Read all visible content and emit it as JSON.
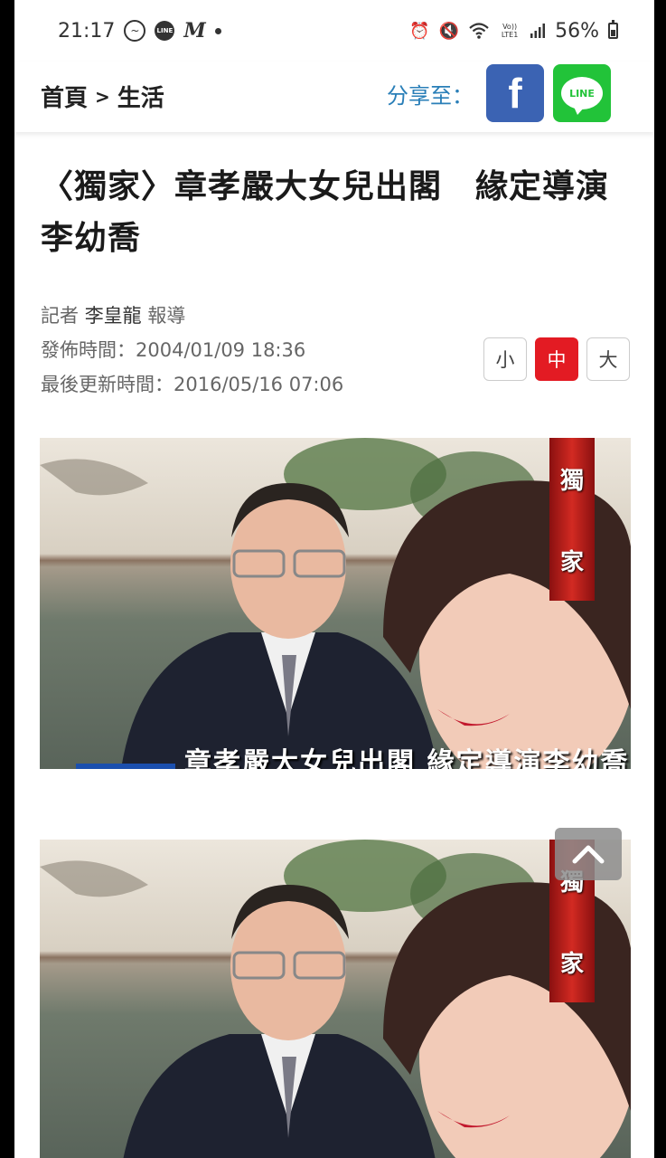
{
  "status_bar": {
    "time": "21:17",
    "battery": "56%",
    "left_icons": [
      "messenger-icon",
      "line-icon",
      "m-app-icon",
      "notification-dot-icon"
    ],
    "right_icons": [
      "alarm-icon",
      "mute-icon",
      "wifi-icon",
      "volte-icon",
      "signal-icon",
      "battery-icon"
    ],
    "volte_text": "Vo))\nLTE1",
    "line_badge": "LINE",
    "m_badge": "M",
    "battery_level": 0.56
  },
  "header": {
    "breadcrumb_home": "首頁",
    "breadcrumb_sep": ">",
    "breadcrumb_section": "生活",
    "share_label": "分享至：",
    "facebook_label": "f",
    "line_label": "LINE"
  },
  "article": {
    "title": "〈獨家〉章孝嚴大女兒出閣　緣定導演李幼喬",
    "reporter_prefix": "記者",
    "reporter_name": "李皇龍",
    "reporter_suffix": "報導",
    "published": "發佈時間：2004/01/09 18:36",
    "updated": "最後更新時間：2016/05/16 07:06"
  },
  "font_size": {
    "small": "小",
    "medium": "中",
    "large": "大",
    "active": "medium"
  },
  "photos": [
    {
      "tag_top": "獨",
      "tag_bottom": "家",
      "caption": "章孝嚴大女兒出閣 緣定導演李幼喬"
    },
    {
      "tag_top": "獨",
      "tag_bottom": "家"
    }
  ],
  "colors": {
    "accent_red": "#e31b23",
    "facebook_blue": "#3b63b3",
    "line_green": "#22c339",
    "share_blue": "#2a7fb8"
  }
}
